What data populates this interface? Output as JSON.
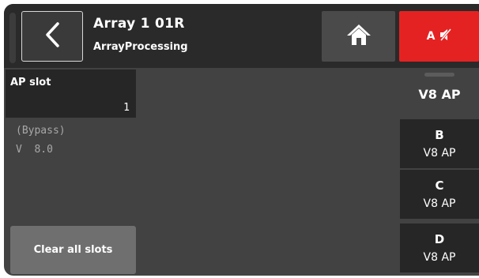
{
  "header": {
    "title": "Array 1 01R",
    "subtitle": "ArrayProcessing",
    "back_icon": "chevron-left-icon",
    "home_icon": "home-icon",
    "mute": {
      "label": "A",
      "icon": "speaker-muted-icon",
      "color": "#e52222"
    }
  },
  "slot": {
    "label": "AP slot",
    "value": "1"
  },
  "info": {
    "bypass": "(Bypass)",
    "version": "V  8.0"
  },
  "clear_button": {
    "label": "Clear all slots"
  },
  "sidebar": {
    "active": {
      "label": "V8 AP"
    },
    "items": [
      {
        "letter": "B",
        "label": "V8 AP"
      },
      {
        "letter": "C",
        "label": "V8 AP"
      },
      {
        "letter": "D",
        "label": "V8 AP"
      }
    ]
  }
}
